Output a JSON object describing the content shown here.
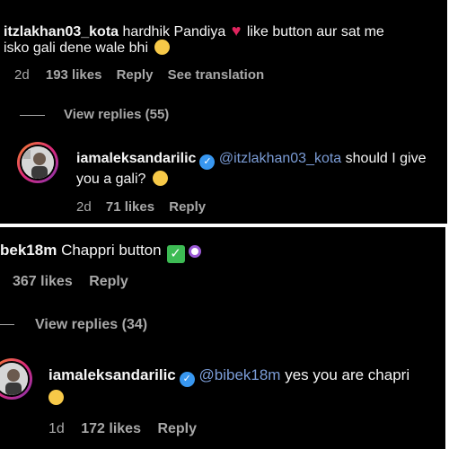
{
  "top": {
    "comment": {
      "username": "itzlakhan03_kota",
      "text_line1_a": "hardhik Pandiya",
      "text_line1_b": "like button aur sat me",
      "text_line2": "isko gali dene wale bhi",
      "age": "2d",
      "likes": "193 likes",
      "reply": "Reply",
      "see_translation": "See translation",
      "view_replies": "View replies (55)"
    },
    "reply": {
      "username": "iamaleksandarilic",
      "mention": "@itzlakhan03_kota",
      "text_line1": "should I give",
      "text_line2": "you a gali?",
      "age": "2d",
      "likes": "71 likes",
      "reply": "Reply"
    }
  },
  "bottom": {
    "comment": {
      "username": "bek18m",
      "text": "Chappri button",
      "likes": "367 likes",
      "reply": "Reply",
      "view_replies": "View replies (34)"
    },
    "reply": {
      "username": "iamaleksandarilic",
      "mention": "@bibek18m",
      "text": "yes you are chapri",
      "age": "1d",
      "likes": "172 likes",
      "reply": "Reply"
    }
  },
  "colors": {
    "background": "#000000",
    "text": "#f5f5f5",
    "meta": "#a8a8a8",
    "mention": "#7b9cd6",
    "verified": "#3897f0"
  }
}
